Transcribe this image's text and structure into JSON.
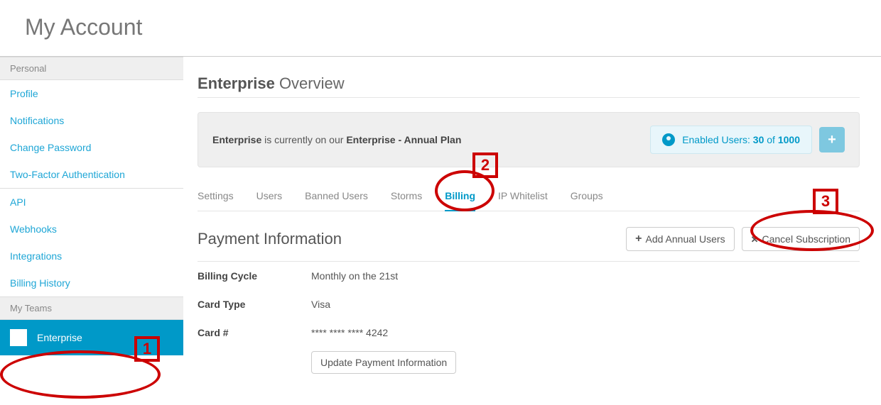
{
  "header": {
    "title": "My Account"
  },
  "sidebar": {
    "groups": [
      {
        "label": "Personal",
        "items": [
          {
            "label": "Profile"
          },
          {
            "label": "Notifications"
          },
          {
            "label": "Change Password"
          },
          {
            "label": "Two-Factor Authentication"
          }
        ]
      },
      {
        "label": "",
        "items": [
          {
            "label": "API"
          },
          {
            "label": "Webhooks"
          },
          {
            "label": "Integrations"
          },
          {
            "label": "Billing History"
          }
        ]
      },
      {
        "label": "My Teams",
        "items": [
          {
            "label": "Enterprise",
            "active": true
          }
        ]
      }
    ]
  },
  "main": {
    "title_strong": "Enterprise",
    "title_rest": " Overview",
    "banner": {
      "prefix_strong": "Enterprise",
      "mid": " is currently on our ",
      "plan_strong": "Enterprise - Annual Plan",
      "enabled_label": "Enabled Users: ",
      "enabled_count": "30",
      "enabled_of": " of ",
      "enabled_total": "1000",
      "add_icon": "+"
    },
    "tabs": [
      {
        "label": "Settings"
      },
      {
        "label": "Users"
      },
      {
        "label": "Banned Users"
      },
      {
        "label": "Storms"
      },
      {
        "label": "Billing",
        "active": true
      },
      {
        "label": "IP Whitelist"
      },
      {
        "label": "Groups"
      }
    ],
    "section_title": "Payment Information",
    "actions": {
      "add_users": "Add Annual Users",
      "cancel": "Cancel Subscription"
    },
    "info": [
      {
        "label": "Billing Cycle",
        "value": "Monthly on the 21st"
      },
      {
        "label": "Card Type",
        "value": "Visa"
      },
      {
        "label": "Card #",
        "value": "**** **** **** 4242"
      }
    ],
    "update_btn": "Update Payment Information"
  },
  "annotations": {
    "n1": "1",
    "n2": "2",
    "n3": "3"
  }
}
